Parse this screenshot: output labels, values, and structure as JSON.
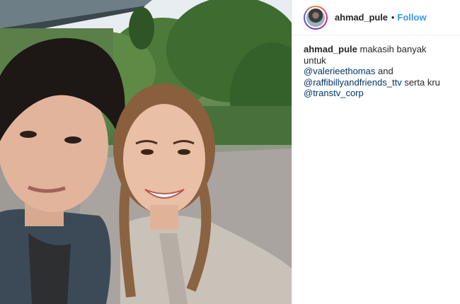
{
  "post": {
    "username": "ahmad_pule",
    "separator": "•",
    "follow_label": "Follow",
    "photo_label": "Selfie photo of two people outdoors",
    "caption": {
      "username": "ahmad_pule",
      "text_1": "makasih banyak untuk",
      "mention_1": "@valerieethomas",
      "text_2": "and",
      "mention_2": "@raffibillyandfriends_ttv",
      "text_3": "serta kru",
      "mention_3": "@transtv_corp"
    }
  }
}
